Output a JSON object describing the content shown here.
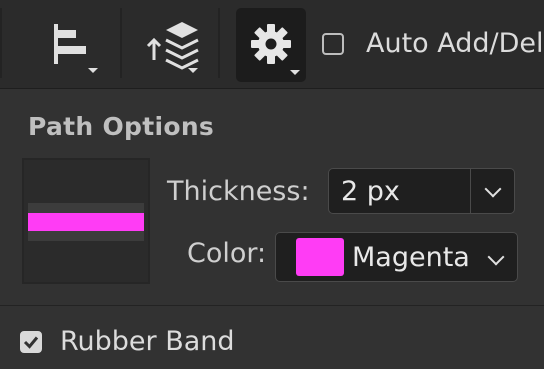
{
  "toolbar": {
    "align_button_icon": "align-left-icon",
    "arrange_button_icon": "arrange-layers-icon",
    "settings_button_icon": "gear-icon",
    "auto_add_delete_label": "Auto Add/Del",
    "auto_add_delete_checked": false
  },
  "path_options": {
    "title": "Path Options",
    "thickness_label": "Thickness:",
    "thickness_value": "2 px",
    "color_label": "Color:",
    "color_value": "Magenta",
    "color_swatch": "#ff3cf5",
    "preview_stroke_color": "#ff3cf5"
  },
  "rubber_band": {
    "label": "Rubber Band",
    "checked": true
  }
}
